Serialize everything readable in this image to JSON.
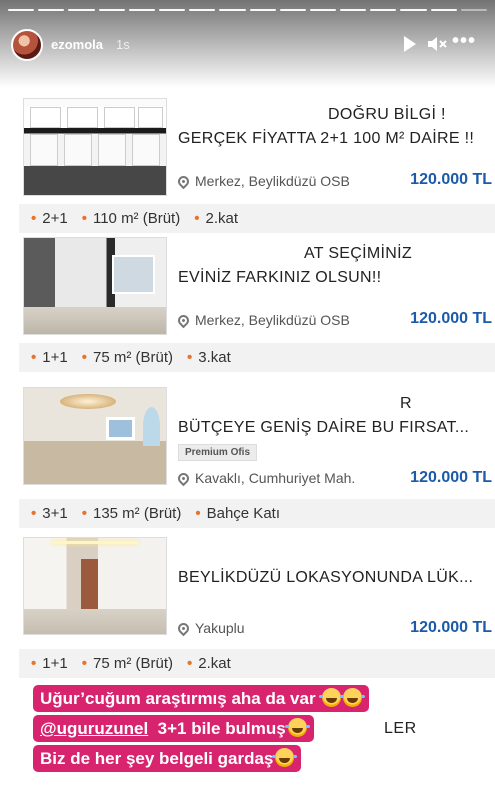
{
  "story": {
    "username": "ezomola",
    "time": "1s",
    "progress_segments": 16,
    "current_segment": 16
  },
  "listings": [
    {
      "title_line1": "DOĞRU BİLGİ !",
      "title_line2": "GERÇEK FİYATTA 2+1 100 M² DAİRE !!",
      "location": "Merkez, Beylikdüzü OSB",
      "price": "120.000 TL",
      "attrs": [
        "2+1",
        "110 m² (Brüt)",
        "2.kat"
      ]
    },
    {
      "title_line1": "AT SEÇİMİNİZ",
      "title_line2": "EVİNİZ FARKINIZ OLSUN!!",
      "location": "Merkez, Beylikdüzü OSB",
      "price": "120.000 TL",
      "attrs": [
        "1+1",
        "75 m² (Brüt)",
        "3.kat"
      ]
    },
    {
      "title_line1": "R",
      "title_line2": "BÜTÇEYE GENİŞ DAİRE BU FIRSAT...",
      "badge": "Premium Ofis",
      "location": "Kavaklı, Cumhuriyet Mah.",
      "price": "120.000 TL",
      "attrs": [
        "3+1",
        "135 m² (Brüt)",
        "Bahçe Katı"
      ]
    },
    {
      "title_line1": "",
      "title_line2": "BEYLİKDÜZÜ LOKASYONUNDA LÜK...",
      "location": "Yakuplu",
      "price": "120.000 TL",
      "attrs": [
        "1+1",
        "75 m² (Brüt)",
        "2.kat"
      ]
    }
  ],
  "caption": {
    "line1": "Uğur’cuğum araştırmış aha da var",
    "line2_mention": "@uguruzunel",
    "line2_text": "3+1 bile bulmuş",
    "line3": "Biz de her şey belgeli gardaş",
    "partial_text": "LER"
  }
}
